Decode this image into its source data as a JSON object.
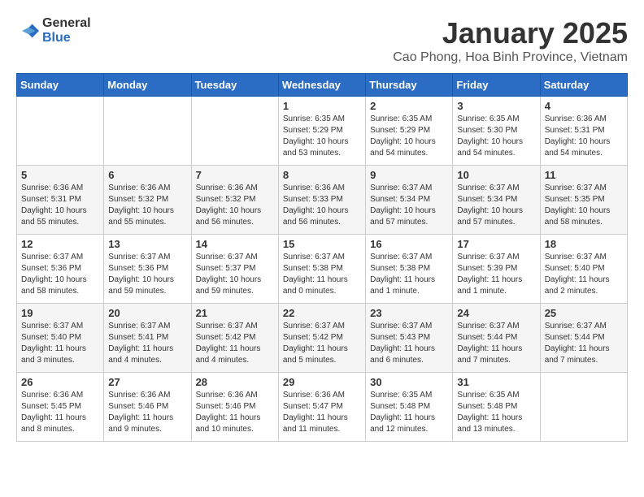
{
  "logo": {
    "line1": "General",
    "line2": "Blue"
  },
  "title": "January 2025",
  "subtitle": "Cao Phong, Hoa Binh Province, Vietnam",
  "weekdays": [
    "Sunday",
    "Monday",
    "Tuesday",
    "Wednesday",
    "Thursday",
    "Friday",
    "Saturday"
  ],
  "weeks": [
    [
      {
        "day": "",
        "info": ""
      },
      {
        "day": "",
        "info": ""
      },
      {
        "day": "",
        "info": ""
      },
      {
        "day": "1",
        "info": "Sunrise: 6:35 AM\nSunset: 5:29 PM\nDaylight: 10 hours\nand 53 minutes."
      },
      {
        "day": "2",
        "info": "Sunrise: 6:35 AM\nSunset: 5:29 PM\nDaylight: 10 hours\nand 54 minutes."
      },
      {
        "day": "3",
        "info": "Sunrise: 6:35 AM\nSunset: 5:30 PM\nDaylight: 10 hours\nand 54 minutes."
      },
      {
        "day": "4",
        "info": "Sunrise: 6:36 AM\nSunset: 5:31 PM\nDaylight: 10 hours\nand 54 minutes."
      }
    ],
    [
      {
        "day": "5",
        "info": "Sunrise: 6:36 AM\nSunset: 5:31 PM\nDaylight: 10 hours\nand 55 minutes."
      },
      {
        "day": "6",
        "info": "Sunrise: 6:36 AM\nSunset: 5:32 PM\nDaylight: 10 hours\nand 55 minutes."
      },
      {
        "day": "7",
        "info": "Sunrise: 6:36 AM\nSunset: 5:32 PM\nDaylight: 10 hours\nand 56 minutes."
      },
      {
        "day": "8",
        "info": "Sunrise: 6:36 AM\nSunset: 5:33 PM\nDaylight: 10 hours\nand 56 minutes."
      },
      {
        "day": "9",
        "info": "Sunrise: 6:37 AM\nSunset: 5:34 PM\nDaylight: 10 hours\nand 57 minutes."
      },
      {
        "day": "10",
        "info": "Sunrise: 6:37 AM\nSunset: 5:34 PM\nDaylight: 10 hours\nand 57 minutes."
      },
      {
        "day": "11",
        "info": "Sunrise: 6:37 AM\nSunset: 5:35 PM\nDaylight: 10 hours\nand 58 minutes."
      }
    ],
    [
      {
        "day": "12",
        "info": "Sunrise: 6:37 AM\nSunset: 5:36 PM\nDaylight: 10 hours\nand 58 minutes."
      },
      {
        "day": "13",
        "info": "Sunrise: 6:37 AM\nSunset: 5:36 PM\nDaylight: 10 hours\nand 59 minutes."
      },
      {
        "day": "14",
        "info": "Sunrise: 6:37 AM\nSunset: 5:37 PM\nDaylight: 10 hours\nand 59 minutes."
      },
      {
        "day": "15",
        "info": "Sunrise: 6:37 AM\nSunset: 5:38 PM\nDaylight: 11 hours\nand 0 minutes."
      },
      {
        "day": "16",
        "info": "Sunrise: 6:37 AM\nSunset: 5:38 PM\nDaylight: 11 hours\nand 1 minute."
      },
      {
        "day": "17",
        "info": "Sunrise: 6:37 AM\nSunset: 5:39 PM\nDaylight: 11 hours\nand 1 minute."
      },
      {
        "day": "18",
        "info": "Sunrise: 6:37 AM\nSunset: 5:40 PM\nDaylight: 11 hours\nand 2 minutes."
      }
    ],
    [
      {
        "day": "19",
        "info": "Sunrise: 6:37 AM\nSunset: 5:40 PM\nDaylight: 11 hours\nand 3 minutes."
      },
      {
        "day": "20",
        "info": "Sunrise: 6:37 AM\nSunset: 5:41 PM\nDaylight: 11 hours\nand 4 minutes."
      },
      {
        "day": "21",
        "info": "Sunrise: 6:37 AM\nSunset: 5:42 PM\nDaylight: 11 hours\nand 4 minutes."
      },
      {
        "day": "22",
        "info": "Sunrise: 6:37 AM\nSunset: 5:42 PM\nDaylight: 11 hours\nand 5 minutes."
      },
      {
        "day": "23",
        "info": "Sunrise: 6:37 AM\nSunset: 5:43 PM\nDaylight: 11 hours\nand 6 minutes."
      },
      {
        "day": "24",
        "info": "Sunrise: 6:37 AM\nSunset: 5:44 PM\nDaylight: 11 hours\nand 7 minutes."
      },
      {
        "day": "25",
        "info": "Sunrise: 6:37 AM\nSunset: 5:44 PM\nDaylight: 11 hours\nand 7 minutes."
      }
    ],
    [
      {
        "day": "26",
        "info": "Sunrise: 6:36 AM\nSunset: 5:45 PM\nDaylight: 11 hours\nand 8 minutes."
      },
      {
        "day": "27",
        "info": "Sunrise: 6:36 AM\nSunset: 5:46 PM\nDaylight: 11 hours\nand 9 minutes."
      },
      {
        "day": "28",
        "info": "Sunrise: 6:36 AM\nSunset: 5:46 PM\nDaylight: 11 hours\nand 10 minutes."
      },
      {
        "day": "29",
        "info": "Sunrise: 6:36 AM\nSunset: 5:47 PM\nDaylight: 11 hours\nand 11 minutes."
      },
      {
        "day": "30",
        "info": "Sunrise: 6:35 AM\nSunset: 5:48 PM\nDaylight: 11 hours\nand 12 minutes."
      },
      {
        "day": "31",
        "info": "Sunrise: 6:35 AM\nSunset: 5:48 PM\nDaylight: 11 hours\nand 13 minutes."
      },
      {
        "day": "",
        "info": ""
      }
    ]
  ]
}
